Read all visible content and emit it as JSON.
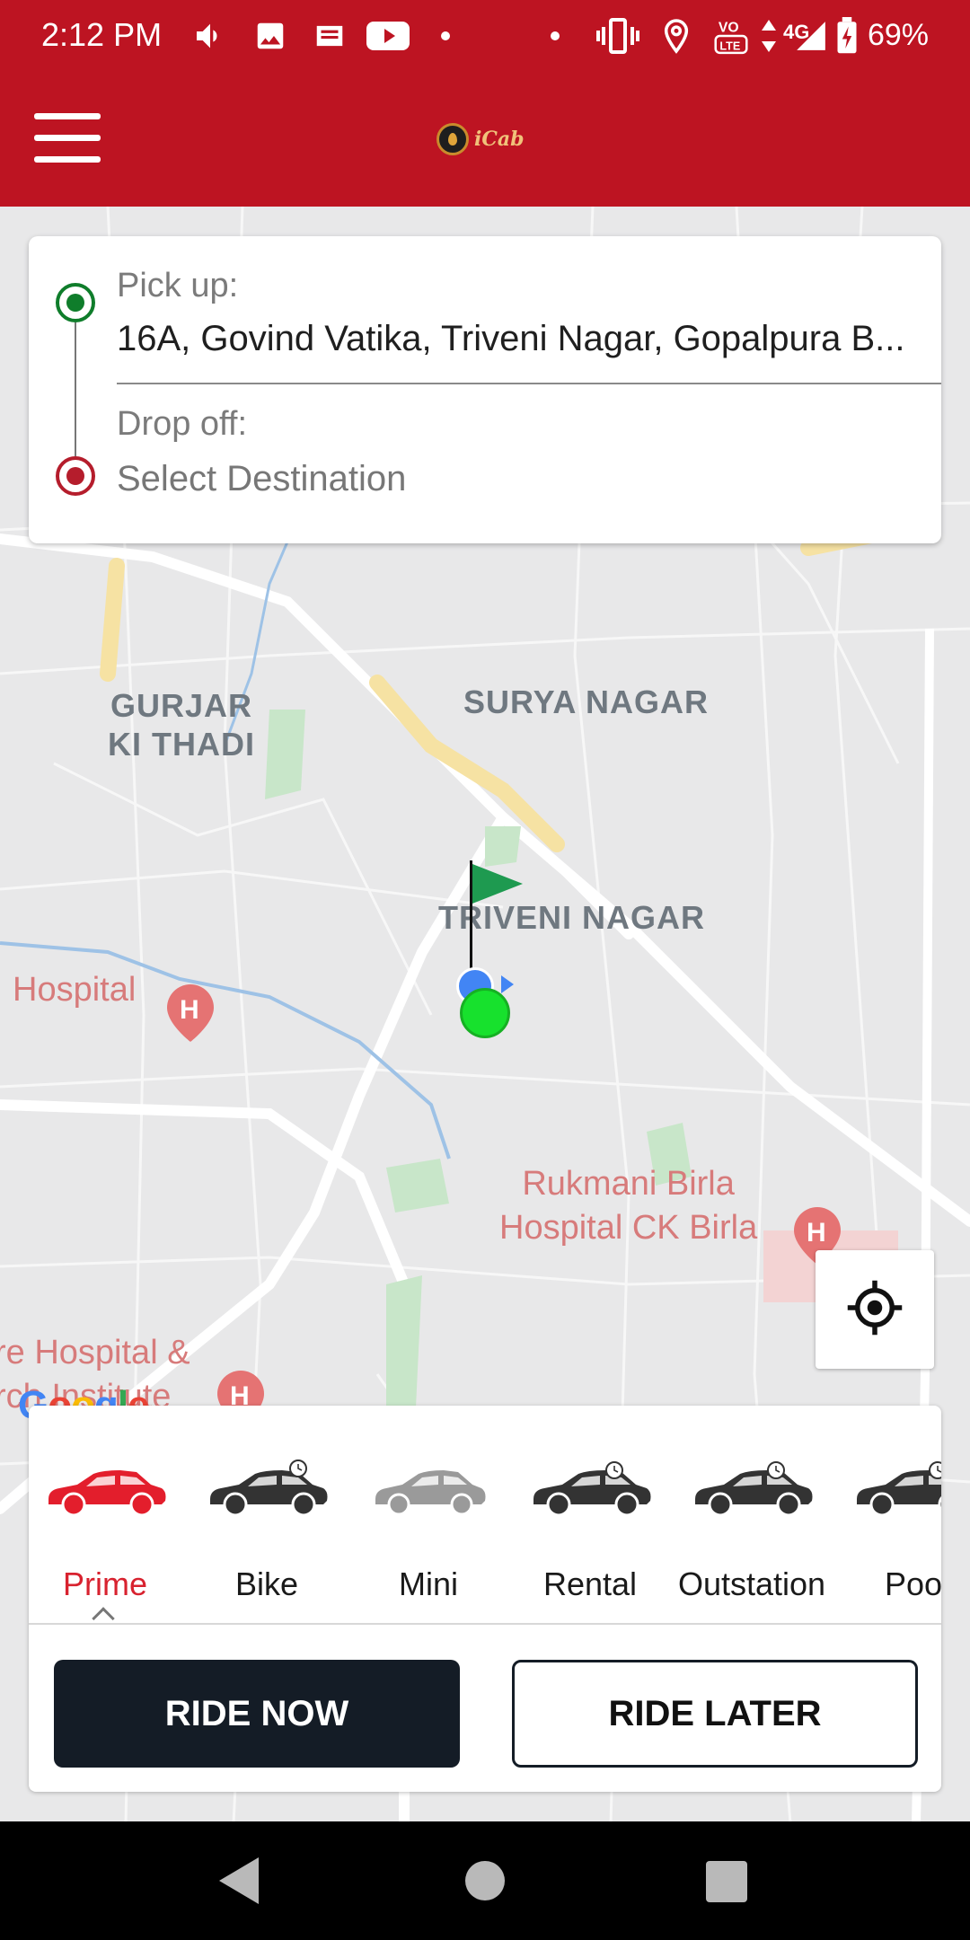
{
  "status_bar": {
    "time": "2:12 PM",
    "battery": "69%",
    "network": "4G",
    "icons": [
      "volume-icon",
      "image-icon",
      "news-icon",
      "youtube-icon",
      "vibrate-icon",
      "location-icon",
      "volte-icon",
      "signal-icon",
      "battery-icon"
    ]
  },
  "app_bar": {
    "logo_text": "iCab",
    "menu_icon": "hamburger-menu-icon"
  },
  "location_card": {
    "pickup_label": "Pick up:",
    "pickup_value": "16A, Govind Vatika, Triveni Nagar, Gopalpura B...",
    "dropoff_label": "Drop off:",
    "dropoff_value": "Select Destination"
  },
  "map": {
    "labels": {
      "gurjar": "GURJAR\nKI THADI",
      "surya": "SURYA NAGAR",
      "triveni": "TRIVENI NAGAR",
      "hospital": "Hospital",
      "rukmani": "Rukmani Birla\nHospital CK Birla",
      "hospital_institute": "re Hospital &\nrch Institute"
    },
    "google_logo": "Google"
  },
  "vehicles": [
    {
      "name": "Prime",
      "selected": true,
      "color": "#d8222f"
    },
    {
      "name": "Bike",
      "selected": false,
      "color": "#333333"
    },
    {
      "name": "Mini",
      "selected": false,
      "color": "#9a9a9a"
    },
    {
      "name": "Rental",
      "selected": false,
      "color": "#333333"
    },
    {
      "name": "Outstation",
      "selected": false,
      "color": "#333333"
    },
    {
      "name": "Poo",
      "selected": false,
      "color": "#333333"
    }
  ],
  "actions": {
    "ride_now": "RIDE NOW",
    "ride_later": "RIDE LATER"
  },
  "colors": {
    "brand": "#bd1422",
    "primary_button": "#141c26",
    "selected_vehicle": "#d8222f",
    "pickup_dot": "#0f7d2b",
    "dropoff_dot": "#b51d2c"
  }
}
